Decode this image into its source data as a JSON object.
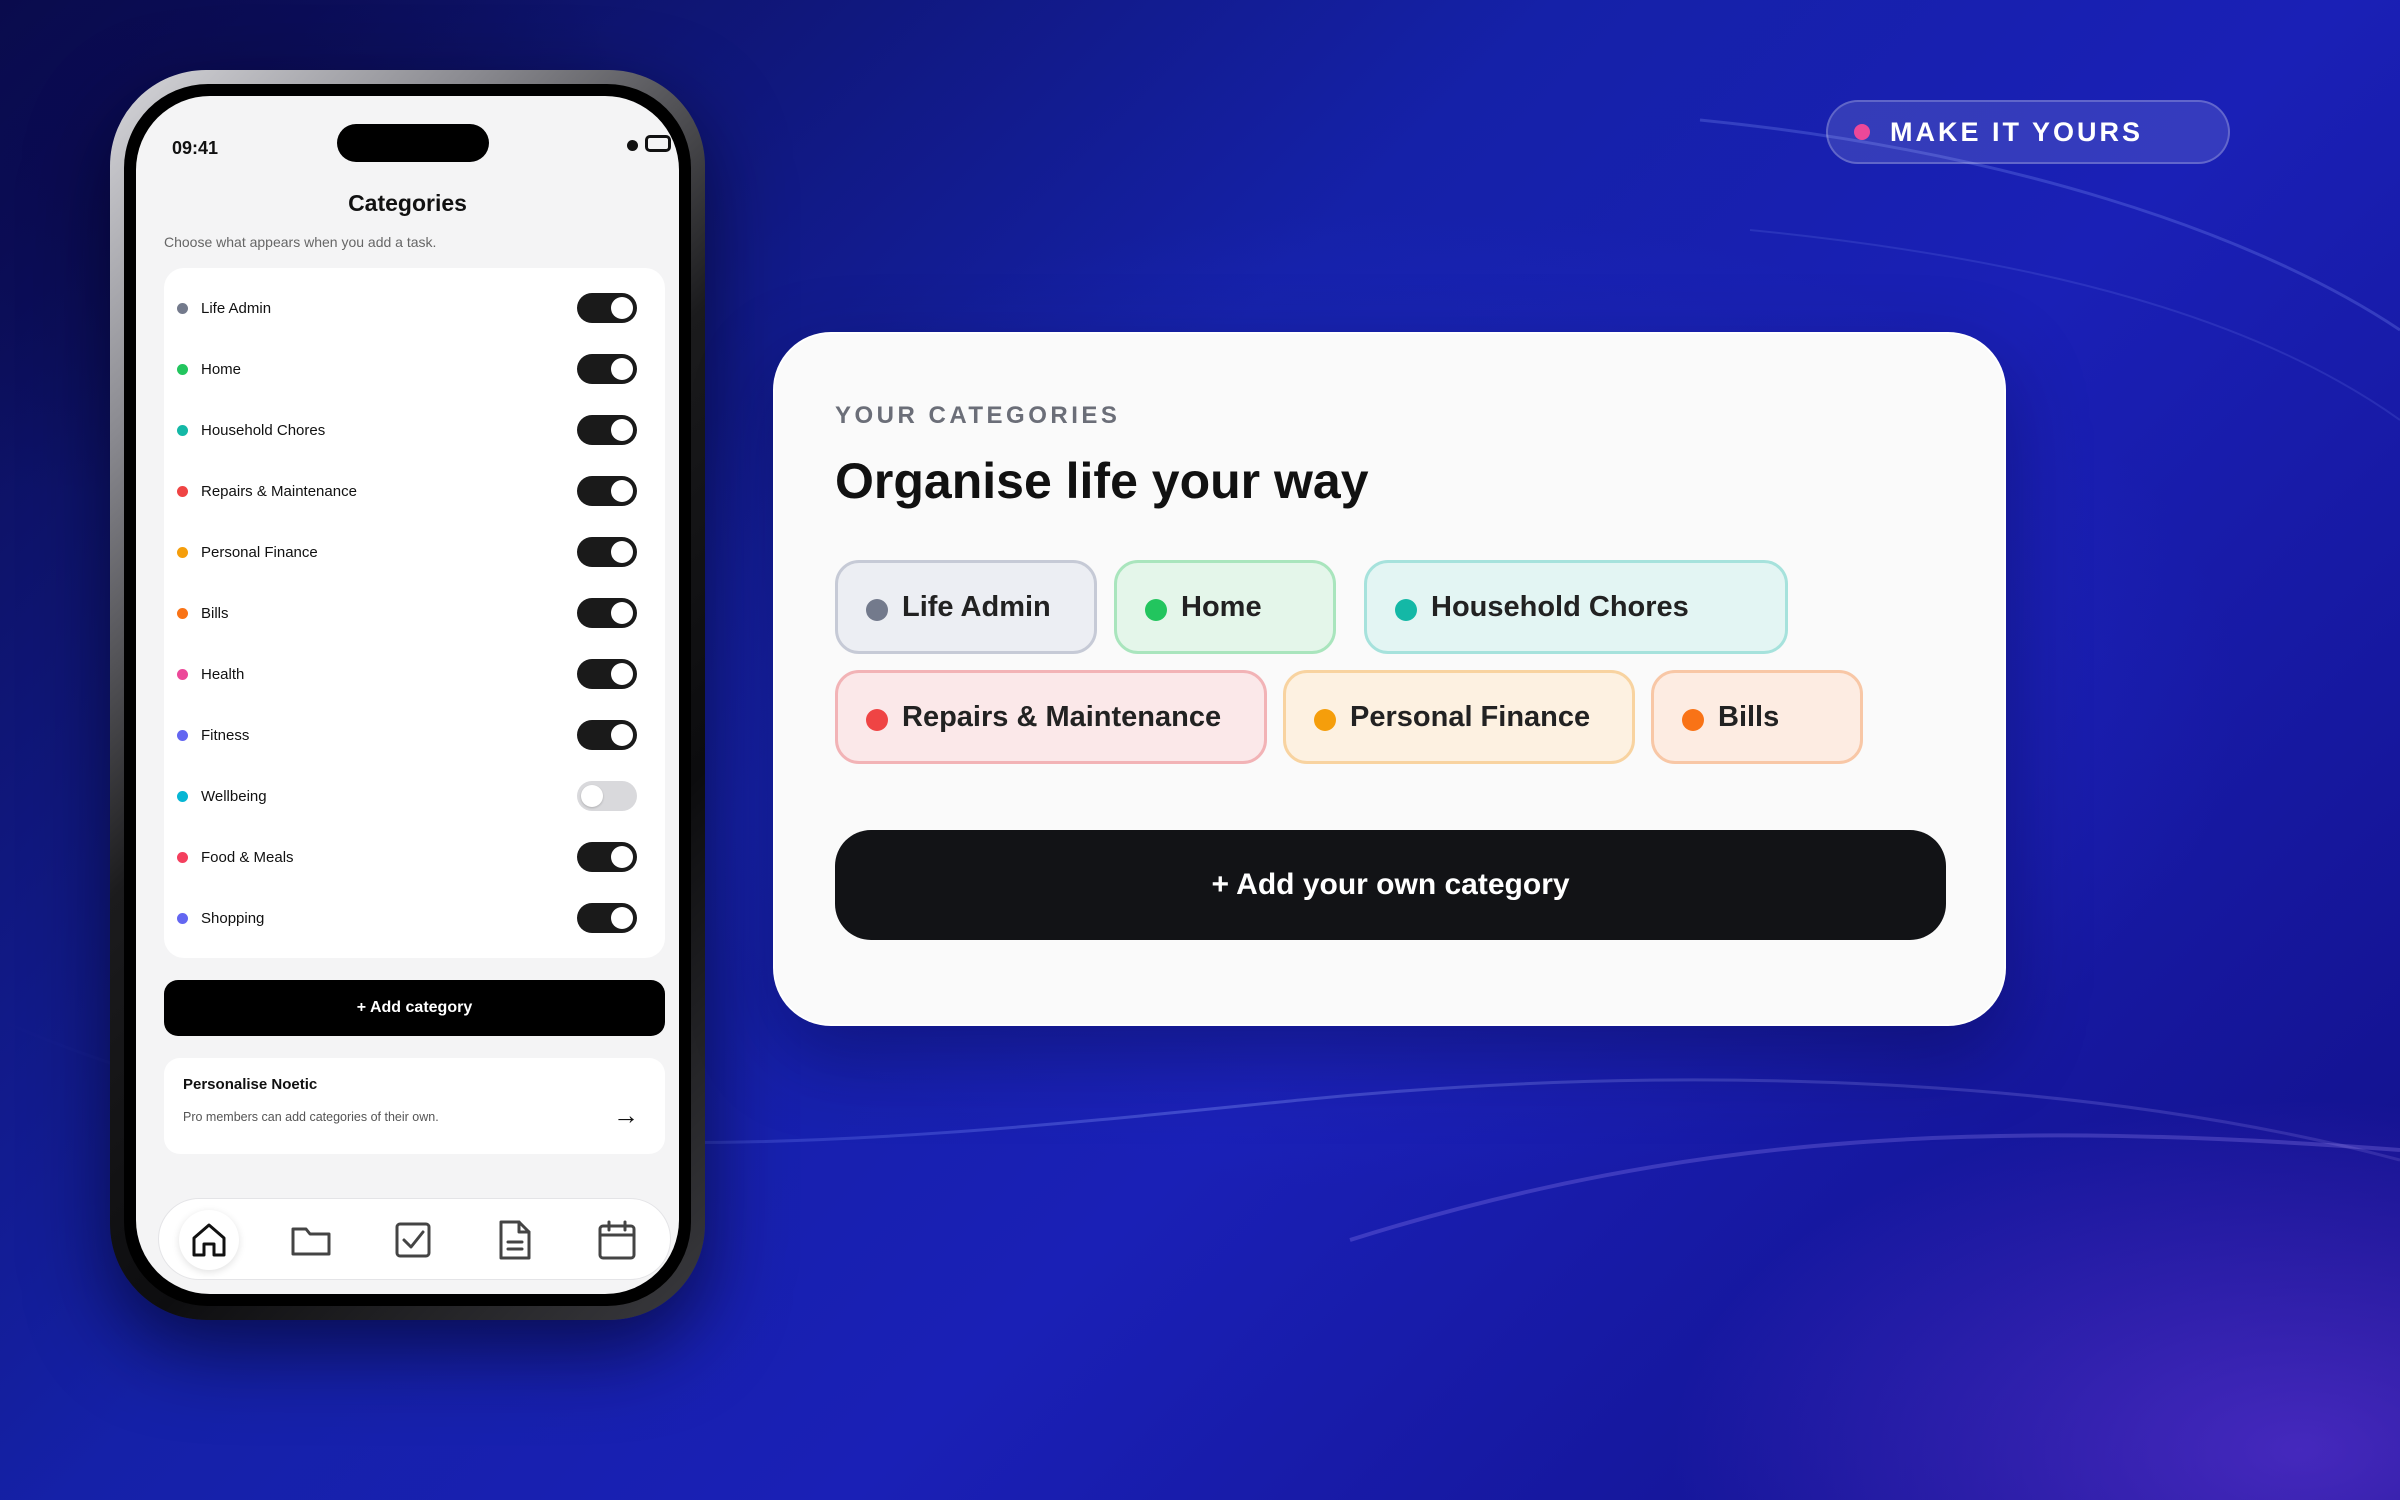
{
  "badge": {
    "label": "MAKE IT YOURS",
    "dot_color": "#ec4899"
  },
  "phone": {
    "status_time": "09:41",
    "title": "Categories",
    "subtitle": "Choose what appears when you add a task.",
    "categories": [
      {
        "label": "Life Admin",
        "color": "#737a8c",
        "enabled": true
      },
      {
        "label": "Home",
        "color": "#22c55e",
        "enabled": true
      },
      {
        "label": "Household Chores",
        "color": "#14b8a6",
        "enabled": true
      },
      {
        "label": "Repairs & Maintenance",
        "color": "#ef4444",
        "enabled": true
      },
      {
        "label": "Personal Finance",
        "color": "#f59e0b",
        "enabled": true
      },
      {
        "label": "Bills",
        "color": "#f97316",
        "enabled": true
      },
      {
        "label": "Health",
        "color": "#ec4899",
        "enabled": true
      },
      {
        "label": "Fitness",
        "color": "#6366f1",
        "enabled": true
      },
      {
        "label": "Wellbeing",
        "color": "#06b6d4",
        "enabled": false
      },
      {
        "label": "Food & Meals",
        "color": "#f43f5e",
        "enabled": true
      },
      {
        "label": "Shopping",
        "color": "#6366f1",
        "enabled": true
      }
    ],
    "add_button_label": "+ Add category",
    "promo": {
      "title": "Personalise Noetic",
      "subtitle": "Pro members can add categories of their own.",
      "arrow": "→"
    },
    "tabs": [
      {
        "icon": "home-icon",
        "active": true
      },
      {
        "icon": "folder-icon",
        "active": false
      },
      {
        "icon": "checkbox-icon",
        "active": false
      },
      {
        "icon": "document-icon",
        "active": false
      },
      {
        "icon": "calendar-icon",
        "active": false
      }
    ]
  },
  "card": {
    "eyebrow": "YOUR CATEGORIES",
    "title": "Organise life your way",
    "chips": [
      {
        "label": "Life Admin",
        "color": "#737a8c",
        "bg": "#eceef3",
        "border": "#c6cad6"
      },
      {
        "label": "Home",
        "color": "#22c55e",
        "bg": "#e4f6ea",
        "border": "#a9e5bd"
      },
      {
        "label": "Household Chores",
        "color": "#14b8a6",
        "bg": "#e3f5f3",
        "border": "#a6e2dc"
      },
      {
        "label": "Repairs & Maintenance",
        "color": "#ef4444",
        "bg": "#fbe8e9",
        "border": "#f2b3b6"
      },
      {
        "label": "Personal Finance",
        "color": "#f59e0b",
        "bg": "#fdf1e1",
        "border": "#f8d3a0"
      },
      {
        "label": "Bills",
        "color": "#f97316",
        "bg": "#fdece2",
        "border": "#f8c7a6"
      }
    ],
    "button_label": "+ Add your own category"
  }
}
